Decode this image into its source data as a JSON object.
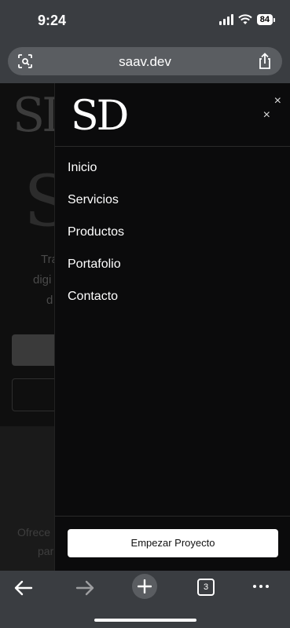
{
  "status_bar": {
    "time": "9:24",
    "battery": "84"
  },
  "browser": {
    "url": "saav.dev",
    "open_tabs": "3"
  },
  "background_page": {
    "logo_small": "SD",
    "logo_big": "S",
    "lines": [
      "Tra",
      "digi",
      "d"
    ],
    "lower_lines": [
      "Ofrece",
      "par"
    ]
  },
  "drawer": {
    "logo": "SD",
    "close_symbol": "×",
    "nav_items": [
      {
        "label": "Inicio"
      },
      {
        "label": "Servicios"
      },
      {
        "label": "Productos"
      },
      {
        "label": "Portafolio"
      },
      {
        "label": "Contacto"
      }
    ],
    "cta_label": "Empezar Proyecto"
  },
  "icons": {
    "wifi": "wifi-icon",
    "signal": "signal-icon",
    "battery": "battery-icon",
    "page_menu": "page-menu-icon",
    "share": "share-icon",
    "back": "arrow-left-icon",
    "forward": "arrow-right-icon",
    "new_tab": "plus-icon",
    "tabs": "tabs-icon",
    "more": "more-icon"
  }
}
